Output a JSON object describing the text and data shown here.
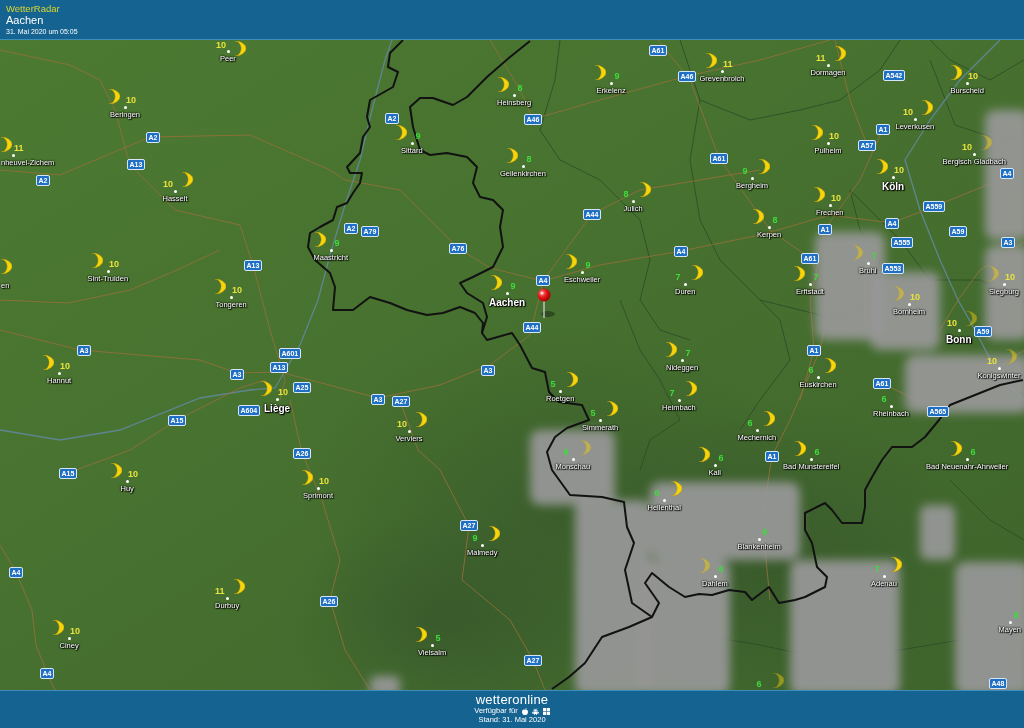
{
  "header": {
    "app_title": "WetterRadar",
    "location": "Aachen",
    "timestamp": "31. Mai 2020 um 05:05"
  },
  "map": {
    "cities": [
      {
        "name": "Peer",
        "temperature": "10",
        "color": "#e8e23c",
        "kind": "town"
      },
      {
        "name": "Grevenbroich",
        "temperature": "11",
        "color": "#e8e23c",
        "kind": "town"
      },
      {
        "name": "Dormagen",
        "temperature": "11",
        "color": "#e8e23c",
        "kind": "town"
      },
      {
        "name": "Erkelenz",
        "temperature": "9",
        "color": "#3bdc3b",
        "kind": "town"
      },
      {
        "name": "Burscheid",
        "temperature": "10",
        "color": "#e8e23c",
        "kind": "town"
      },
      {
        "name": "Heinsberg",
        "temperature": "8",
        "color": "#3bdc3b",
        "kind": "town"
      },
      {
        "name": "Beringen",
        "temperature": "10",
        "color": "#e8e23c",
        "kind": "town"
      },
      {
        "name": "Leverkusen",
        "temperature": "10",
        "color": "#e8e23c",
        "kind": "town"
      },
      {
        "name": "Sittard",
        "temperature": "9",
        "color": "#3bdc3b",
        "kind": "town"
      },
      {
        "name": "Pulheim",
        "temperature": "10",
        "color": "#e8e23c",
        "kind": "town"
      },
      {
        "name": "nheuvel-Zichem",
        "temperature": "11",
        "color": "#e8e23c",
        "kind": "town"
      },
      {
        "name": "Bergisch Gladbach",
        "temperature": "10",
        "color": "#e8e23c",
        "kind": "town"
      },
      {
        "name": "Geilenkirchen",
        "temperature": "8",
        "color": "#3bdc3b",
        "kind": "town"
      },
      {
        "name": "Bergheim",
        "temperature": "9",
        "color": "#3bdc3b",
        "kind": "town"
      },
      {
        "name": "Köln",
        "temperature": "10",
        "color": "#e8e23c",
        "kind": "major"
      },
      {
        "name": "Hasselt",
        "temperature": "10",
        "color": "#e8e23c",
        "kind": "town"
      },
      {
        "name": "Julich",
        "temperature": "8",
        "color": "#3bdc3b",
        "kind": "town"
      },
      {
        "name": "Frechen",
        "temperature": "10",
        "color": "#e8e23c",
        "kind": "town"
      },
      {
        "name": "Kerpen",
        "temperature": "8",
        "color": "#3bdc3b",
        "kind": "town"
      },
      {
        "name": "Maastricht",
        "temperature": "9",
        "color": "#3bdc3b",
        "kind": "town"
      },
      {
        "name": "en",
        "kind": "town"
      },
      {
        "name": "Sint-Truiden",
        "temperature": "10",
        "color": "#e8e23c",
        "kind": "town"
      },
      {
        "name": "Eschweiler",
        "temperature": "9",
        "color": "#3bdc3b",
        "kind": "town"
      },
      {
        "name": "Duren",
        "temperature": "7",
        "color": "#3bdc3b",
        "kind": "town"
      },
      {
        "name": "Erftstadt",
        "temperature": "7",
        "color": "#3bdc3b",
        "kind": "town"
      },
      {
        "name": "Bruhl",
        "temperature": "7",
        "color": "#3bdc3b",
        "kind": "town"
      },
      {
        "name": "Siegburg",
        "temperature": "10",
        "color": "#e8e23c",
        "kind": "town"
      },
      {
        "name": "Tongeren",
        "temperature": "10",
        "color": "#e8e23c",
        "kind": "town"
      },
      {
        "name": "Aachen",
        "temperature": "9",
        "color": "#3bdc3b",
        "kind": "major"
      },
      {
        "name": "Bornheim",
        "temperature": "10",
        "color": "#e8e23c",
        "kind": "town"
      },
      {
        "name": "Bonn",
        "temperature": "10",
        "color": "#e8e23c",
        "kind": "major"
      },
      {
        "name": "Hannut",
        "temperature": "10",
        "color": "#e8e23c",
        "kind": "town"
      },
      {
        "name": "Nideggen",
        "temperature": "7",
        "color": "#3bdc3b",
        "kind": "town"
      },
      {
        "name": "Euskirchen",
        "temperature": "6",
        "color": "#3bdc3b",
        "kind": "town"
      },
      {
        "name": "Konigswinter",
        "temperature": "10",
        "color": "#e8e23c",
        "kind": "town"
      },
      {
        "name": "Liège",
        "temperature": "10",
        "color": "#e8e23c",
        "kind": "major"
      },
      {
        "name": "Roetgen",
        "temperature": "5",
        "color": "#3bdc3b",
        "kind": "town"
      },
      {
        "name": "Heimbach",
        "temperature": "7",
        "color": "#3bdc3b",
        "kind": "town"
      },
      {
        "name": "Rheinbach",
        "temperature": "6",
        "color": "#3bdc3b",
        "kind": "town"
      },
      {
        "name": "Verviers",
        "temperature": "10",
        "color": "#e8e23c",
        "kind": "town"
      },
      {
        "name": "Simmerath",
        "temperature": "5",
        "color": "#3bdc3b",
        "kind": "town"
      },
      {
        "name": "Mechernich",
        "temperature": "6",
        "color": "#3bdc3b",
        "kind": "town"
      },
      {
        "name": "Monschau",
        "temperature": "6",
        "color": "#3bdc3b",
        "kind": "town"
      },
      {
        "name": "Kall",
        "temperature": "6",
        "color": "#3bdc3b",
        "kind": "town"
      },
      {
        "name": "Bad Munstereifel",
        "temperature": "6",
        "color": "#3bdc3b",
        "kind": "town"
      },
      {
        "name": "Bad Neuenahr-Ahrweiler",
        "temperature": "6",
        "color": "#3bdc3b",
        "kind": "town"
      },
      {
        "name": "Huy",
        "temperature": "10",
        "color": "#e8e23c",
        "kind": "town"
      },
      {
        "name": "Sprimont",
        "temperature": "10",
        "color": "#e8e23c",
        "kind": "town"
      },
      {
        "name": "Hellenthal",
        "temperature": "6",
        "color": "#3bdc3b",
        "kind": "town"
      },
      {
        "name": "Malmedy",
        "temperature": "9",
        "color": "#3bdc3b",
        "kind": "town"
      },
      {
        "name": "Blankenheim",
        "temperature": "6",
        "color": "#3bdc3b",
        "kind": "town"
      },
      {
        "name": "Dahlem",
        "temperature": "6",
        "color": "#3bdc3b",
        "kind": "town"
      },
      {
        "name": "Adenau",
        "temperature": "7",
        "color": "#3bdc3b",
        "kind": "town"
      },
      {
        "name": "Durbuy",
        "temperature": "11",
        "color": "#e8e23c",
        "kind": "town"
      },
      {
        "name": "Mayen",
        "temperature": "8",
        "color": "#3bdc3b",
        "kind": "town"
      },
      {
        "name": "Ciney",
        "temperature": "10",
        "color": "#e8e23c",
        "kind": "town"
      },
      {
        "name": "Vielsalm",
        "temperature": "5",
        "color": "#3bdc3b",
        "kind": "town"
      },
      {
        "temperature": "6",
        "color": "#3bdc3b",
        "kind": "town"
      }
    ],
    "road_shields": [
      "A61",
      "A46",
      "A542",
      "A2",
      "A46",
      "A1",
      "A2",
      "A57",
      "A13",
      "A61",
      "A2",
      "A4",
      "A44",
      "A559",
      "A2",
      "A79",
      "A1",
      "A4",
      "A59",
      "A76",
      "A4",
      "A555",
      "A3",
      "A13",
      "A61",
      "A553",
      "A4",
      "A44",
      "A59",
      "A3",
      "A601",
      "A1",
      "A3",
      "A13",
      "A3",
      "A25",
      "A61",
      "A15",
      "A604",
      "A3",
      "A27",
      "A565",
      "A26",
      "A1",
      "A15",
      "A27",
      "A4",
      "A26",
      "A27",
      "A4",
      "A48"
    ]
  },
  "footer": {
    "brand": "wetteronline",
    "availability": "Verfügbar für",
    "stand": "Stand: 31. Mai 2020"
  }
}
